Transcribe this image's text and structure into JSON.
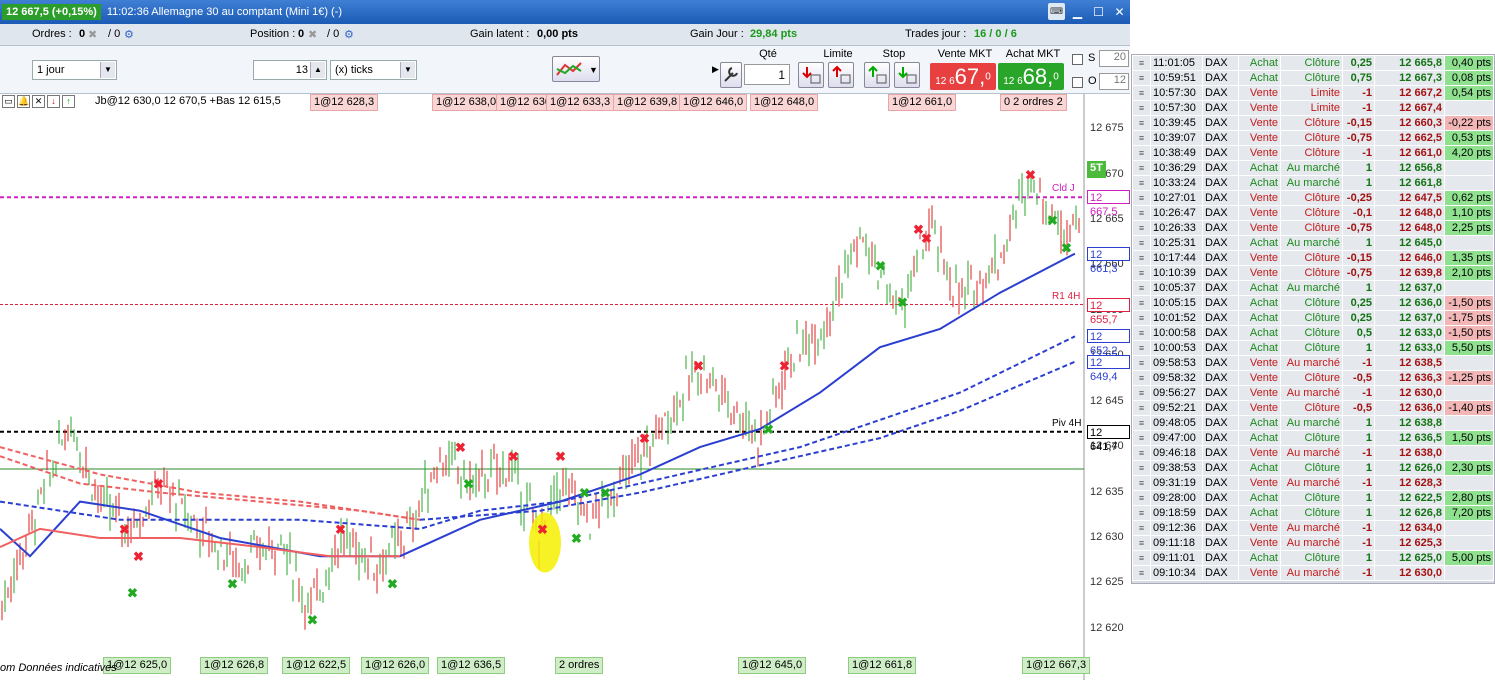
{
  "window": {
    "price_badge": "12 667,5 (+0,15%)",
    "title": "11:02:36 Allemagne 30 au comptant (Mini 1€) (-)",
    "kb_icon": "keyboard-icon"
  },
  "info": {
    "ordres_label": "Ordres :",
    "ordres_val": "0",
    "ordres_sep": "/ 0",
    "position_label": "Position :",
    "position_val": "0",
    "position_sep": "/ 0",
    "gain_latent_label": "Gain latent :",
    "gain_latent_val": "0,00 pts",
    "gain_jour_label": "Gain Jour :",
    "gain_jour_val": "29,84 pts",
    "trades_label": "Trades jour :",
    "trades_val": "16 / 0 / 6"
  },
  "toolbar": {
    "period": "1 jour",
    "ticks_val": "13",
    "ticks_unit": "(x) ticks"
  },
  "order": {
    "qty_label": "Qté",
    "qty": "1",
    "limit_label": "Limite",
    "stop_label": "Stop",
    "sell_label": "Vente MKT",
    "buy_label": "Achat MKT",
    "sell_small": "12 6",
    "sell_big": "67,",
    "sell_sup": "0",
    "buy_small": "12 6",
    "buy_big": "68,",
    "buy_sup": "0",
    "s_label": "S",
    "s_val": "20",
    "o_label": "O",
    "o_val": "12"
  },
  "chart": {
    "yticks": [
      "12 675",
      "12 670",
      "12 665",
      "12 660",
      "12 655",
      "12 650",
      "12 645",
      "12 640",
      "12 635",
      "12 630",
      "12 625",
      "12 620"
    ],
    "ymin": 12618,
    "ymax": 12677,
    "lines": [
      {
        "label": "Cld J",
        "value": 12667.5,
        "tag": "12 667,5",
        "color": "#d020c0"
      },
      {
        "label": "",
        "value": 12661.3,
        "tag": "12 661,3",
        "color": "#2b3fd0"
      },
      {
        "label": "R1 4H",
        "value": 12655.7,
        "tag": "12 655,7",
        "color": "#e02040"
      },
      {
        "label": "",
        "value": 12652.2,
        "tag": "12 652,2",
        "color": "#2b3fd0"
      },
      {
        "label": "",
        "value": 12649.4,
        "tag": "12 649,4",
        "color": "#2b3fd0"
      },
      {
        "label": "Piv 4H",
        "value": 12641.7,
        "tag": "12 641,7",
        "color": "#000000"
      }
    ],
    "last_tag": "5T",
    "top_labels": [
      "Jb@12 630,0 12 670,5 +Bas 12 615,5",
      "1@12 628,3",
      "1@12 638,0",
      "1@12 636,0",
      "1@12 633,3",
      "1@12 639,8",
      "1@12 646,0",
      "1@12 648,0",
      "1@12 661,0",
      "0 2 ordres 2"
    ],
    "bottom_labels": [
      "1@12 625,0",
      "1@12 626,8",
      "1@12 622,5",
      "1@12 626,0",
      "1@12 636,5",
      "2 ordres",
      "1@12 645,0",
      "1@12 661,8",
      "1@12 667,3"
    ],
    "footer": "om Données indicatives"
  },
  "trades": [
    {
      "t": "11:01:05",
      "s": "DAX",
      "side": "Achat",
      "type": "Clôture",
      "q": "0,25",
      "px": "12 665,8",
      "pl": "0,40 pts"
    },
    {
      "t": "10:59:51",
      "s": "DAX",
      "side": "Achat",
      "type": "Clôture",
      "q": "0,75",
      "px": "12 667,3",
      "pl": "0,08 pts"
    },
    {
      "t": "10:57:30",
      "s": "DAX",
      "side": "Vente",
      "type": "Limite",
      "q": "-1",
      "px": "12 667,2",
      "pl": "0,54 pts"
    },
    {
      "t": "10:57:30",
      "s": "DAX",
      "side": "Vente",
      "type": "Limite",
      "q": "-1",
      "px": "12 667,4",
      "pl": ""
    },
    {
      "t": "10:39:45",
      "s": "DAX",
      "side": "Vente",
      "type": "Clôture",
      "q": "-0,15",
      "px": "12 660,3",
      "pl": "-0,22 pts"
    },
    {
      "t": "10:39:07",
      "s": "DAX",
      "side": "Vente",
      "type": "Clôture",
      "q": "-0,75",
      "px": "12 662,5",
      "pl": "0,53 pts"
    },
    {
      "t": "10:38:49",
      "s": "DAX",
      "side": "Vente",
      "type": "Clôture",
      "q": "-1",
      "px": "12 661,0",
      "pl": "4,20 pts"
    },
    {
      "t": "10:36:29",
      "s": "DAX",
      "side": "Achat",
      "type": "Au marché",
      "q": "1",
      "px": "12 656,8",
      "pl": ""
    },
    {
      "t": "10:33:24",
      "s": "DAX",
      "side": "Achat",
      "type": "Au marché",
      "q": "1",
      "px": "12 661,8",
      "pl": ""
    },
    {
      "t": "10:27:01",
      "s": "DAX",
      "side": "Vente",
      "type": "Clôture",
      "q": "-0,25",
      "px": "12 647,5",
      "pl": "0,62 pts"
    },
    {
      "t": "10:26:47",
      "s": "DAX",
      "side": "Vente",
      "type": "Clôture",
      "q": "-0,1",
      "px": "12 648,0",
      "pl": "1,10 pts"
    },
    {
      "t": "10:26:33",
      "s": "DAX",
      "side": "Vente",
      "type": "Clôture",
      "q": "-0,75",
      "px": "12 648,0",
      "pl": "2,25 pts"
    },
    {
      "t": "10:25:31",
      "s": "DAX",
      "side": "Achat",
      "type": "Au marché",
      "q": "1",
      "px": "12 645,0",
      "pl": ""
    },
    {
      "t": "10:17:44",
      "s": "DAX",
      "side": "Vente",
      "type": "Clôture",
      "q": "-0,15",
      "px": "12 646,0",
      "pl": "1,35 pts"
    },
    {
      "t": "10:10:39",
      "s": "DAX",
      "side": "Vente",
      "type": "Clôture",
      "q": "-0,75",
      "px": "12 639,8",
      "pl": "2,10 pts"
    },
    {
      "t": "10:05:37",
      "s": "DAX",
      "side": "Achat",
      "type": "Au marché",
      "q": "1",
      "px": "12 637,0",
      "pl": ""
    },
    {
      "t": "10:05:15",
      "s": "DAX",
      "side": "Achat",
      "type": "Clôture",
      "q": "0,25",
      "px": "12 636,0",
      "pl": "-1,50 pts"
    },
    {
      "t": "10:01:52",
      "s": "DAX",
      "side": "Achat",
      "type": "Clôture",
      "q": "0,25",
      "px": "12 637,0",
      "pl": "-1,75 pts"
    },
    {
      "t": "10:00:58",
      "s": "DAX",
      "side": "Achat",
      "type": "Clôture",
      "q": "0,5",
      "px": "12 633,0",
      "pl": "-1,50 pts"
    },
    {
      "t": "10:00:53",
      "s": "DAX",
      "side": "Achat",
      "type": "Clôture",
      "q": "1",
      "px": "12 633,0",
      "pl": "5,50 pts"
    },
    {
      "t": "09:58:53",
      "s": "DAX",
      "side": "Vente",
      "type": "Au marché",
      "q": "-1",
      "px": "12 638,5",
      "pl": ""
    },
    {
      "t": "09:58:32",
      "s": "DAX",
      "side": "Vente",
      "type": "Clôture",
      "q": "-0,5",
      "px": "12 636,3",
      "pl": "-1,25 pts"
    },
    {
      "t": "09:56:27",
      "s": "DAX",
      "side": "Vente",
      "type": "Au marché",
      "q": "-1",
      "px": "12 630,0",
      "pl": ""
    },
    {
      "t": "09:52:21",
      "s": "DAX",
      "side": "Vente",
      "type": "Clôture",
      "q": "-0,5",
      "px": "12 636,0",
      "pl": "-1,40 pts"
    },
    {
      "t": "09:48:05",
      "s": "DAX",
      "side": "Achat",
      "type": "Au marché",
      "q": "1",
      "px": "12 638,8",
      "pl": ""
    },
    {
      "t": "09:47:00",
      "s": "DAX",
      "side": "Achat",
      "type": "Clôture",
      "q": "1",
      "px": "12 636,5",
      "pl": "1,50 pts"
    },
    {
      "t": "09:46:18",
      "s": "DAX",
      "side": "Vente",
      "type": "Au marché",
      "q": "-1",
      "px": "12 638,0",
      "pl": ""
    },
    {
      "t": "09:38:53",
      "s": "DAX",
      "side": "Achat",
      "type": "Clôture",
      "q": "1",
      "px": "12 626,0",
      "pl": "2,30 pts"
    },
    {
      "t": "09:31:19",
      "s": "DAX",
      "side": "Vente",
      "type": "Au marché",
      "q": "-1",
      "px": "12 628,3",
      "pl": ""
    },
    {
      "t": "09:28:00",
      "s": "DAX",
      "side": "Achat",
      "type": "Clôture",
      "q": "1",
      "px": "12 622,5",
      "pl": "2,80 pts"
    },
    {
      "t": "09:18:59",
      "s": "DAX",
      "side": "Achat",
      "type": "Clôture",
      "q": "1",
      "px": "12 626,8",
      "pl": "7,20 pts"
    },
    {
      "t": "09:12:36",
      "s": "DAX",
      "side": "Vente",
      "type": "Au marché",
      "q": "-1",
      "px": "12 634,0",
      "pl": ""
    },
    {
      "t": "09:11:18",
      "s": "DAX",
      "side": "Vente",
      "type": "Au marché",
      "q": "-1",
      "px": "12 625,3",
      "pl": ""
    },
    {
      "t": "09:11:01",
      "s": "DAX",
      "side": "Achat",
      "type": "Clôture",
      "q": "1",
      "px": "12 625,0",
      "pl": "5,00 pts"
    },
    {
      "t": "09:10:34",
      "s": "DAX",
      "side": "Vente",
      "type": "Au marché",
      "q": "-1",
      "px": "12 630,0",
      "pl": ""
    }
  ]
}
